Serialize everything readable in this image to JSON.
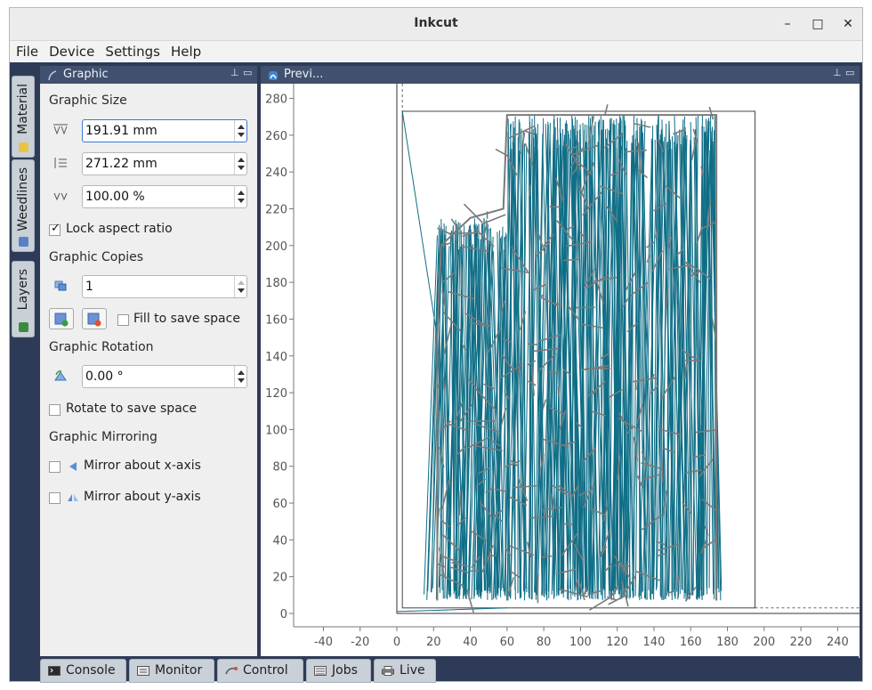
{
  "window": {
    "title": "Inkcut",
    "min_icon": "minimize-icon",
    "max_icon": "maximize-icon",
    "close_icon": "close-icon",
    "min_glyph": "–",
    "max_glyph": "□",
    "close_glyph": "✕"
  },
  "menu": [
    "File",
    "Device",
    "Settings",
    "Help"
  ],
  "side_tabs": [
    "Material",
    "Weedlines",
    "Layers"
  ],
  "dock_left": {
    "title": "Graphic",
    "pin_glyph": "⊥",
    "float_glyph": "▭"
  },
  "dock_right": {
    "title": "Previ...",
    "pin_glyph": "⊥",
    "float_glyph": "▭"
  },
  "graphic_size": {
    "header": "Graphic Size",
    "width_value": "191.91 mm",
    "height_value": "271.22 mm",
    "scale_value": "100.00 %",
    "lock_label": "Lock aspect ratio",
    "lock_checked": true,
    "check_glyph": "✓"
  },
  "graphic_copies": {
    "header": "Graphic Copies",
    "value": "1",
    "fill_label": "Fill to save space",
    "fill_checked": false
  },
  "graphic_rotation": {
    "header": "Graphic Rotation",
    "value": "0.00 °",
    "rotate_label": "Rotate to save space",
    "rotate_checked": false
  },
  "graphic_mirroring": {
    "header": "Graphic Mirroring",
    "mirror_x_label": "Mirror about x-axis",
    "mirror_y_label": "Mirror about y-axis"
  },
  "bottom_tabs": [
    "Console",
    "Monitor",
    "Control",
    "Jobs",
    "Live"
  ],
  "colors": {
    "accent": "#0f6e86",
    "outline": "#7a7a7a",
    "chrome": "#2e3b58",
    "dock_title": "#41506f"
  },
  "chart_data": {
    "type": "scatter",
    "xlim": [
      -40,
      240
    ],
    "ylim": [
      0,
      280
    ],
    "x_ticks": [
      "-40",
      "-20",
      "0",
      "20",
      "40",
      "60",
      "80",
      "100",
      "120",
      "140",
      "160",
      "180",
      "200",
      "220",
      "240"
    ],
    "y_ticks": [
      "0",
      "20",
      "40",
      "60",
      "80",
      "100",
      "120",
      "140",
      "160",
      "180",
      "200",
      "220",
      "240",
      "260",
      "280"
    ],
    "media_box": {
      "x": [
        3,
        195
      ],
      "y": [
        3,
        273
      ]
    },
    "graphic_box": {
      "x": [
        22,
        174
      ],
      "y": [
        7,
        271
      ]
    },
    "grid": false
  }
}
